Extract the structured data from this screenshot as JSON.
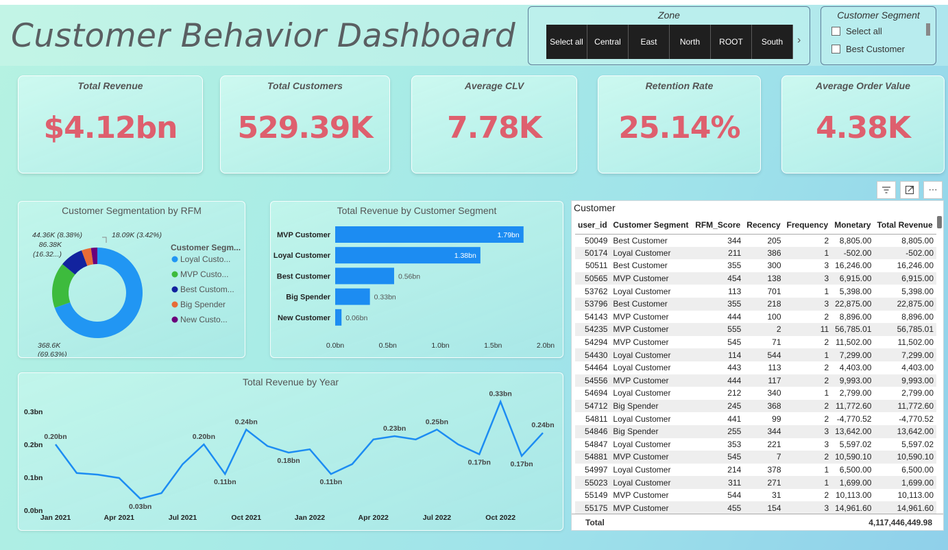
{
  "header": {
    "title": "Customer Behavior Dashboard"
  },
  "zone_slicer": {
    "title": "Zone",
    "options": [
      "Select all",
      "Central",
      "East",
      "North",
      "ROOT",
      "South"
    ]
  },
  "segment_slicer": {
    "title": "Customer Segment",
    "options": [
      "Select all",
      "Best Customer"
    ]
  },
  "kpis": [
    {
      "label": "Total Revenue",
      "value": "$4.12bn"
    },
    {
      "label": "Total Customers",
      "value": "529.39K"
    },
    {
      "label": "Average CLV",
      "value": "7.78K"
    },
    {
      "label": "Retention Rate",
      "value": "25.14%"
    },
    {
      "label": "Average Order Value",
      "value": "4.38K"
    }
  ],
  "colors": {
    "kpi_value": "#de5f6e",
    "bar": "#1c8cf2",
    "line": "#1c8cf2",
    "loyal": "#2196f3",
    "mvp": "#3dbb3d",
    "best": "#12239e",
    "big_spender": "#e66c37",
    "new": "#6b007b"
  },
  "toolbar_icons": [
    "filter-icon",
    "focus-mode-icon",
    "more-options-icon"
  ],
  "chart_data": [
    {
      "type": "pie",
      "title": "Customer Segmentation by RFM",
      "legend_title": "Customer Segm...",
      "slices": [
        {
          "name": "Loyal Custo...",
          "value": 368600,
          "label": "368.6K",
          "pct": "(69.63%)"
        },
        {
          "name": "MVP Custo...",
          "value": 86380,
          "label": "86.38K",
          "pct": "(16.32...)"
        },
        {
          "name": "Best Custom...",
          "value": 44360,
          "label": "44.36K (8.38%)",
          "pct": ""
        },
        {
          "name": "Big Spender",
          "value": 18090,
          "label": "",
          "pct": ""
        },
        {
          "name": "New Custo...",
          "value": 11960,
          "label": "18.09K (3.42%)",
          "pct": ""
        }
      ]
    },
    {
      "type": "bar",
      "title": "Total Revenue by Customer Segment",
      "categories": [
        "MVP Customer",
        "Loyal Customer",
        "Best Customer",
        "Big Spender",
        "New Customer"
      ],
      "values": [
        1.79,
        1.38,
        0.56,
        0.33,
        0.06
      ],
      "labels": [
        "1.79bn",
        "1.38bn",
        "0.56bn",
        "0.33bn",
        "0.06bn"
      ],
      "xticks": [
        "0.0bn",
        "0.5bn",
        "1.0bn",
        "1.5bn",
        "2.0bn"
      ],
      "xlim": [
        0,
        2.0
      ]
    },
    {
      "type": "line",
      "title": "Total Revenue by Year",
      "x": [
        "2021-01",
        "2021-02",
        "2021-03",
        "2021-04",
        "2021-05",
        "2021-06",
        "2021-07",
        "2021-08",
        "2021-09",
        "2021-10",
        "2021-11",
        "2021-12",
        "2022-01",
        "2022-02",
        "2022-03",
        "2022-04",
        "2022-05",
        "2022-06",
        "2022-07",
        "2022-08",
        "2022-09",
        "2022-10",
        "2022-11",
        "2022-12"
      ],
      "values": [
        0.2,
        0.113,
        0.108,
        0.098,
        0.035,
        0.052,
        0.14,
        0.2,
        0.11,
        0.245,
        0.195,
        0.175,
        0.185,
        0.11,
        0.14,
        0.215,
        0.225,
        0.215,
        0.245,
        0.2,
        0.17,
        0.33,
        0.165,
        0.235
      ],
      "point_labels": [
        "0.20bn",
        "",
        "",
        "",
        "0.03bn",
        "",
        "",
        "0.20bn",
        "0.11bn",
        "0.24bn",
        "",
        "0.18bn",
        "",
        "0.11bn",
        "",
        "",
        "0.23bn",
        "",
        "0.25bn",
        "",
        "0.17bn",
        "0.33bn",
        "0.17bn",
        "0.24bn"
      ],
      "xticks": [
        "Jan 2021",
        "Apr 2021",
        "Jul 2021",
        "Oct 2021",
        "Jan 2022",
        "Apr 2022",
        "Jul 2022",
        "Oct 2022"
      ],
      "yticks": [
        "0.0bn",
        "0.1bn",
        "0.2bn",
        "0.3bn"
      ],
      "ylim": [
        0,
        0.3
      ]
    }
  ],
  "table": {
    "title": "Customer",
    "columns": [
      "user_id",
      "Customer Segment",
      "RFM_Score",
      "Recency",
      "Frequency",
      "Monetary",
      "Total Revenue"
    ],
    "rows": [
      [
        "50049",
        "Best Customer",
        "344",
        "205",
        "2",
        "8,805.00",
        "8,805.00"
      ],
      [
        "50174",
        "Loyal Customer",
        "211",
        "386",
        "1",
        "-502.00",
        "-502.00"
      ],
      [
        "50511",
        "Best Customer",
        "355",
        "300",
        "3",
        "16,246.00",
        "16,246.00"
      ],
      [
        "50565",
        "MVP Customer",
        "454",
        "138",
        "3",
        "6,915.00",
        "6,915.00"
      ],
      [
        "53762",
        "Loyal Customer",
        "113",
        "701",
        "1",
        "5,398.00",
        "5,398.00"
      ],
      [
        "53796",
        "Best Customer",
        "355",
        "218",
        "3",
        "22,875.00",
        "22,875.00"
      ],
      [
        "54143",
        "MVP Customer",
        "444",
        "100",
        "2",
        "8,896.00",
        "8,896.00"
      ],
      [
        "54235",
        "MVP Customer",
        "555",
        "2",
        "11",
        "56,785.01",
        "56,785.01"
      ],
      [
        "54294",
        "MVP Customer",
        "545",
        "71",
        "2",
        "11,502.00",
        "11,502.00"
      ],
      [
        "54430",
        "Loyal Customer",
        "114",
        "544",
        "1",
        "7,299.00",
        "7,299.00"
      ],
      [
        "54464",
        "Loyal Customer",
        "443",
        "113",
        "2",
        "4,403.00",
        "4,403.00"
      ],
      [
        "54556",
        "MVP Customer",
        "444",
        "117",
        "2",
        "9,993.00",
        "9,993.00"
      ],
      [
        "54694",
        "Loyal Customer",
        "212",
        "340",
        "1",
        "2,799.00",
        "2,799.00"
      ],
      [
        "54712",
        "Big Spender",
        "245",
        "368",
        "2",
        "11,772.60",
        "11,772.60"
      ],
      [
        "54811",
        "Loyal Customer",
        "441",
        "99",
        "2",
        "-4,770.52",
        "-4,770.52"
      ],
      [
        "54846",
        "Big Spender",
        "255",
        "344",
        "3",
        "13,642.00",
        "13,642.00"
      ],
      [
        "54847",
        "Loyal Customer",
        "353",
        "221",
        "3",
        "5,597.02",
        "5,597.02"
      ],
      [
        "54881",
        "MVP Customer",
        "545",
        "7",
        "2",
        "10,590.10",
        "10,590.10"
      ],
      [
        "54997",
        "Loyal Customer",
        "214",
        "378",
        "1",
        "6,500.00",
        "6,500.00"
      ],
      [
        "55023",
        "Loyal Customer",
        "311",
        "271",
        "1",
        "1,699.00",
        "1,699.00"
      ],
      [
        "55149",
        "MVP Customer",
        "544",
        "31",
        "2",
        "10,113.00",
        "10,113.00"
      ],
      [
        "55175",
        "MVP Customer",
        "455",
        "154",
        "3",
        "14,961.60",
        "14,961.60"
      ]
    ],
    "total_label": "Total",
    "total_value": "4,117,446,449.98"
  }
}
